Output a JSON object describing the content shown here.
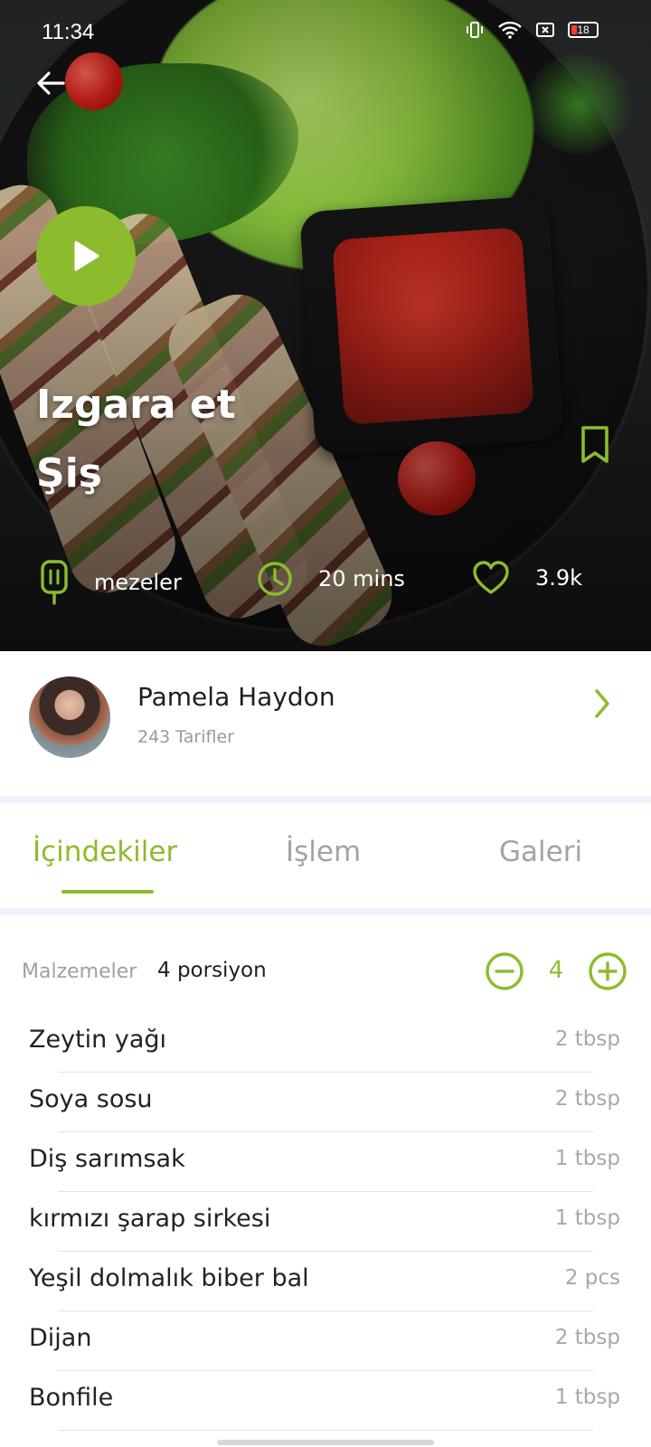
{
  "status_bar": {
    "time": "11:34",
    "battery": "18"
  },
  "recipe": {
    "title_line1": "Izgara et",
    "title_line2": "Şiş",
    "category": "mezeler",
    "duration": "20 mins",
    "likes": "3.9k"
  },
  "author": {
    "name": "Pamela Haydon",
    "recipe_count": "243 Tarifler"
  },
  "tabs": [
    {
      "label": "İçindekiler",
      "active": true
    },
    {
      "label": "İşlem",
      "active": false
    },
    {
      "label": "Galeri",
      "active": false
    }
  ],
  "servings": {
    "label": "Malzemeler",
    "count_label": "4 porsiyon",
    "value": "4"
  },
  "ingredients": [
    {
      "name": "Zeytin yağı",
      "qty": "2 tbsp"
    },
    {
      "name": "Soya sosu",
      "qty": "2 tbsp"
    },
    {
      "name": "Diş sarımsak",
      "qty": "1 tbsp"
    },
    {
      "name": "kırmızı şarap sirkesi",
      "qty": "1 tbsp"
    },
    {
      "name": "Yeşil dolmalık biber bal",
      "qty": "2 pcs"
    },
    {
      "name": "Dijan",
      "qty": "2 tbsp"
    },
    {
      "name": "Bonfile",
      "qty": "1 tbsp"
    }
  ],
  "colors": {
    "accent": "#8cbc2d",
    "muted": "#a3a3a3",
    "divider": "#eef4f9"
  },
  "icons": [
    "back-arrow-icon",
    "play-icon",
    "bookmark-icon",
    "popsicle-icon",
    "clock-icon",
    "heart-icon",
    "chevron-right-icon",
    "minus-circle-icon",
    "plus-circle-icon",
    "vibrate-icon",
    "wifi-icon",
    "battery-icon"
  ]
}
